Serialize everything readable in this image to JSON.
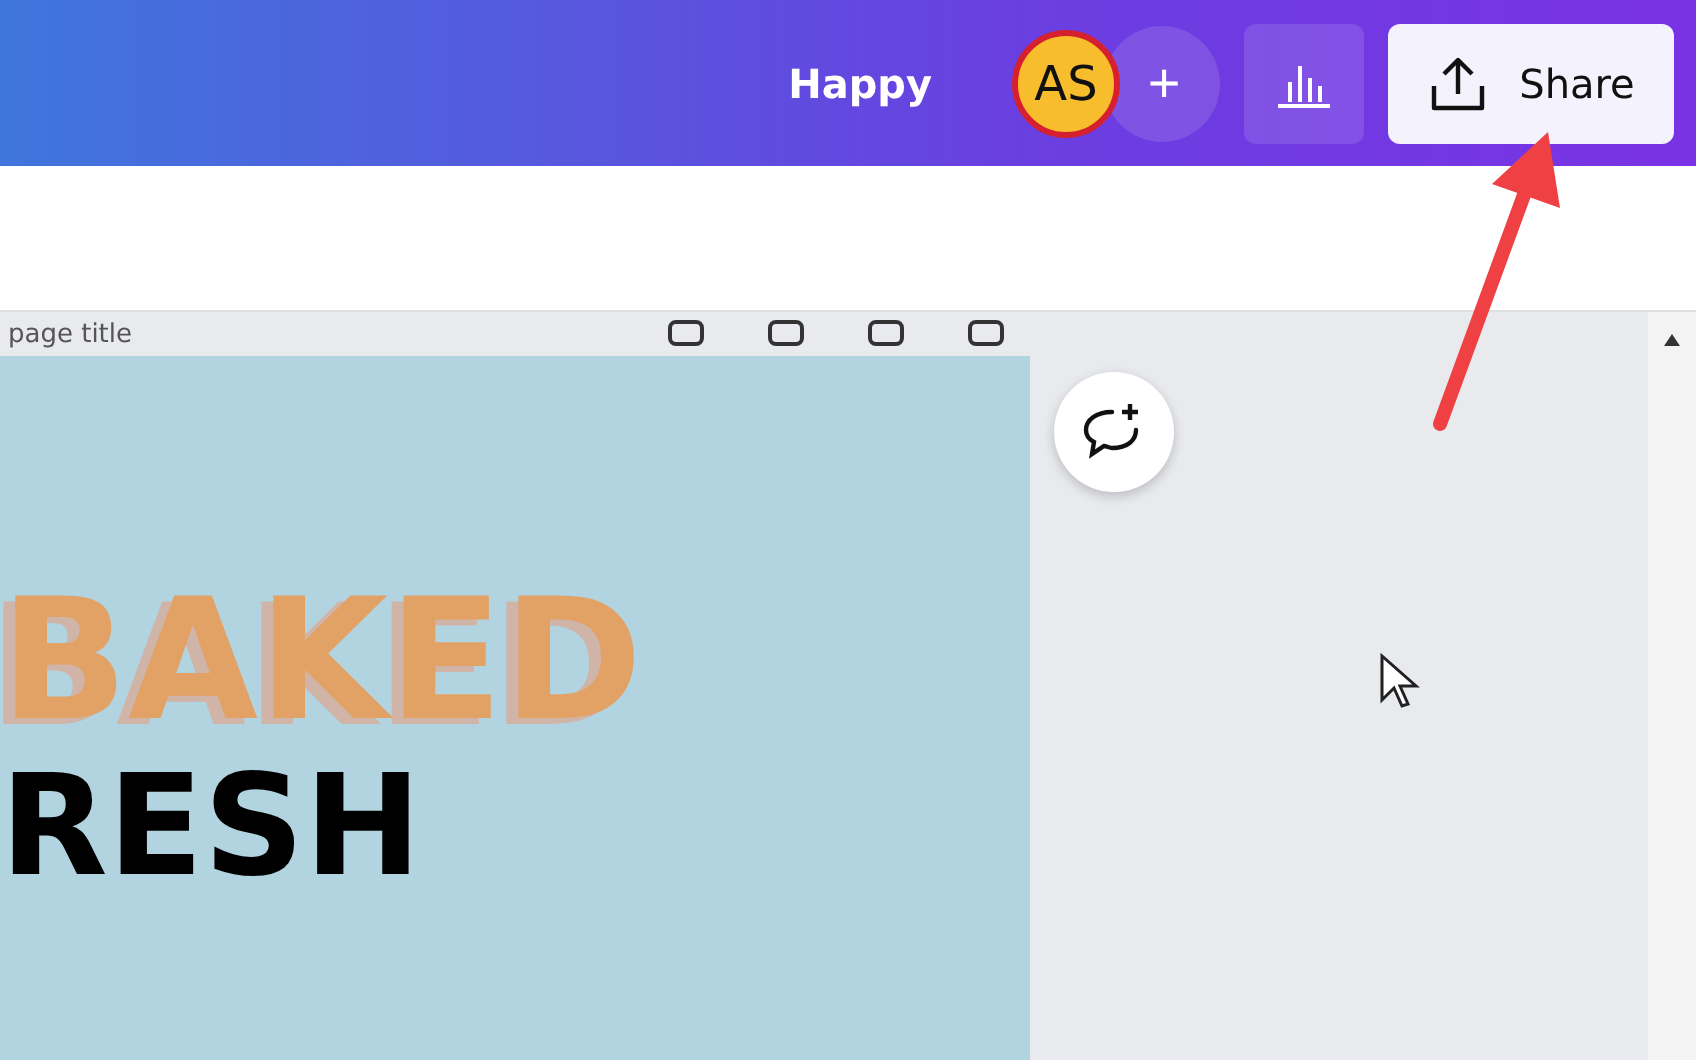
{
  "topbar": {
    "design_name": "Happy",
    "avatar_initials": "AS",
    "add_label": "+",
    "share_label": "Share"
  },
  "canvas": {
    "page_title": "page title",
    "headline": "BAKED",
    "subheadline": "RESH"
  }
}
